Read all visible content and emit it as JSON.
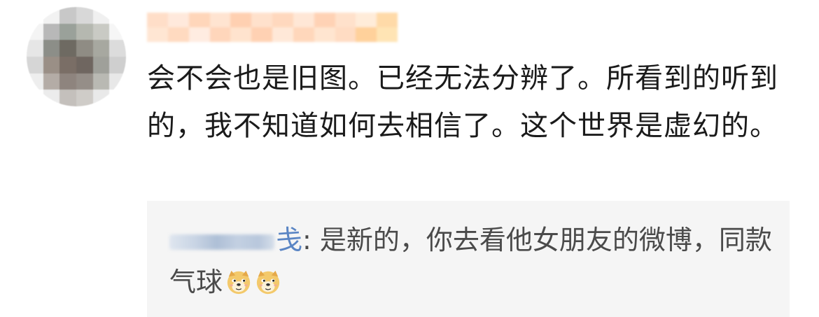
{
  "comment": {
    "username": "",
    "text": "会不会也是旧图。已经无法分辨了。所看到的听到的，我不知道如何去相信了。这个世界是虚幻的。"
  },
  "reply": {
    "author_visible": "戋",
    "separator": ": ",
    "text": "是新的，你去看他女朋友的微博，同款气球",
    "emoji": [
      "doge-icon",
      "doge-icon"
    ]
  },
  "colors": {
    "text": "#1a1a1a",
    "reply_text": "#4a4a4a",
    "reply_author": "#5a85c4",
    "reply_background": "#f5f5f5"
  }
}
